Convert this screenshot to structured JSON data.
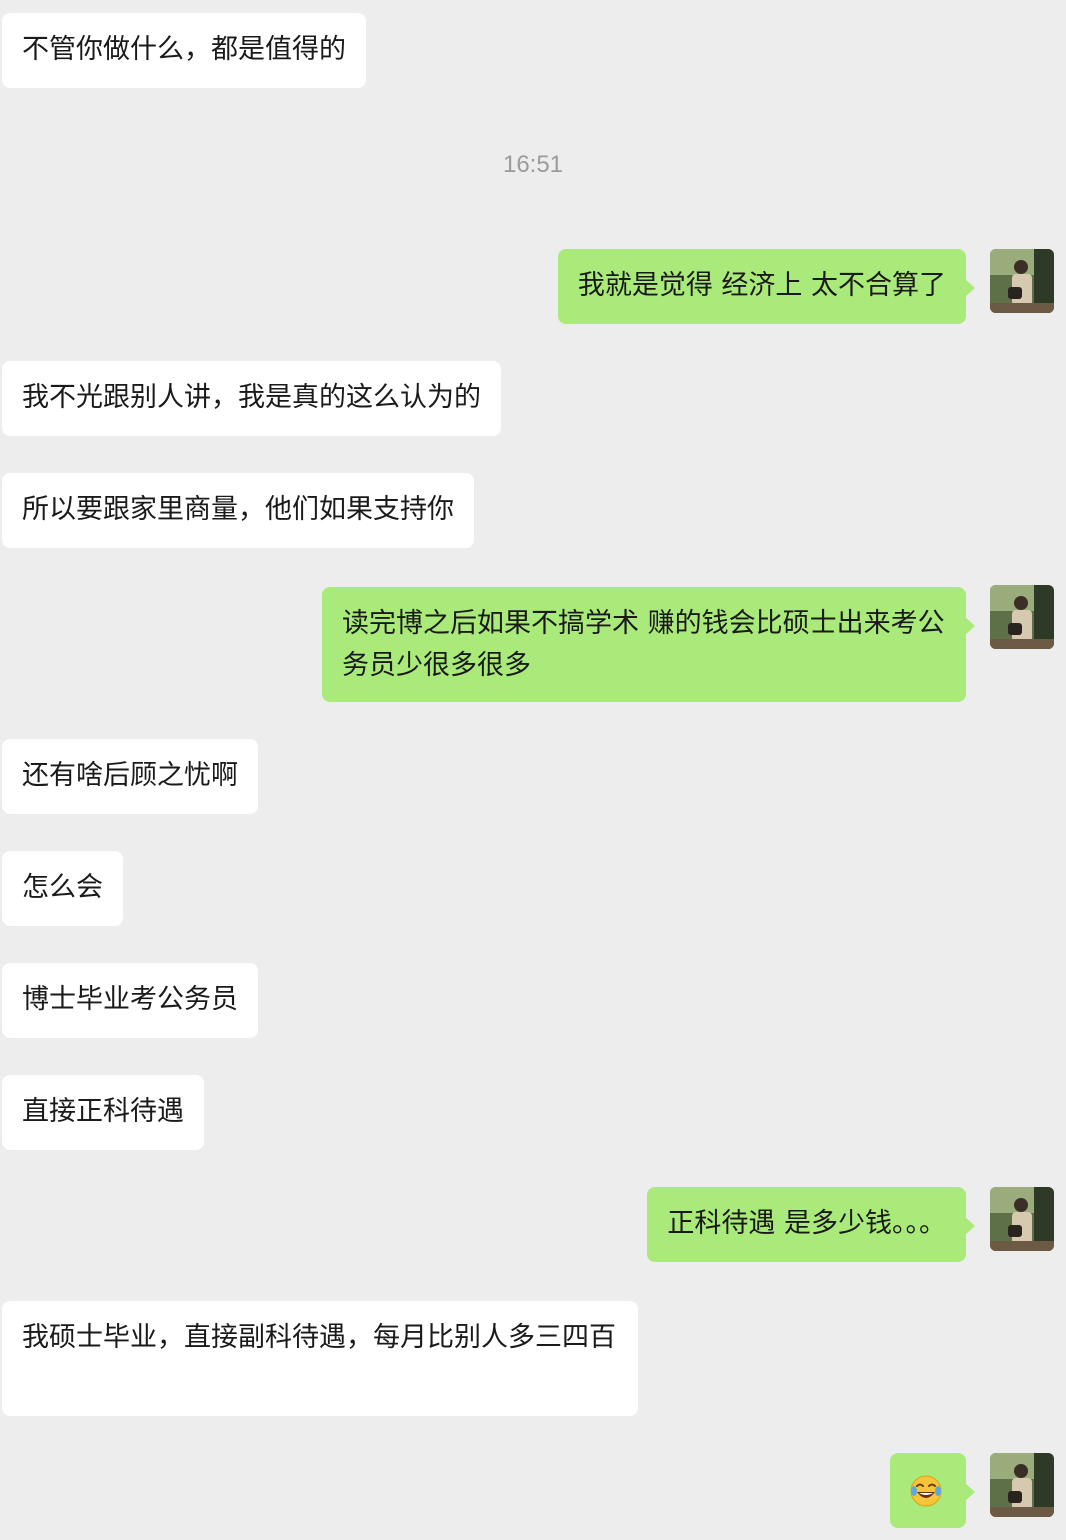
{
  "messages": [
    {
      "text": "不管你做什么，都是值得的"
    },
    {
      "text": "我就是觉得 经济上 太不合算了"
    },
    {
      "text": "我不光跟别人讲，我是真的这么认为的"
    },
    {
      "text": "所以要跟家里商量，他们如果支持你"
    },
    {
      "text": "读完博之后如果不搞学术 赚的钱会比硕士出来考公务员少很多很多"
    },
    {
      "text": "还有啥后顾之忧啊"
    },
    {
      "text": "怎么会"
    },
    {
      "text": "博士毕业考公务员"
    },
    {
      "text": "直接正科待遇"
    },
    {
      "text": "正科待遇 是多少钱。。。"
    },
    {
      "text": "我硕士毕业，直接副科待遇，每月比别人多三四百"
    },
    {
      "emoji": "laughing-tears-emoji-icon"
    }
  ],
  "timestamp": "16:51",
  "colors": {
    "background": "#ededed",
    "incoming_bubble": "#ffffff",
    "outgoing_bubble": "#a9ea7a",
    "timestamp_text": "#9b9b9b"
  }
}
